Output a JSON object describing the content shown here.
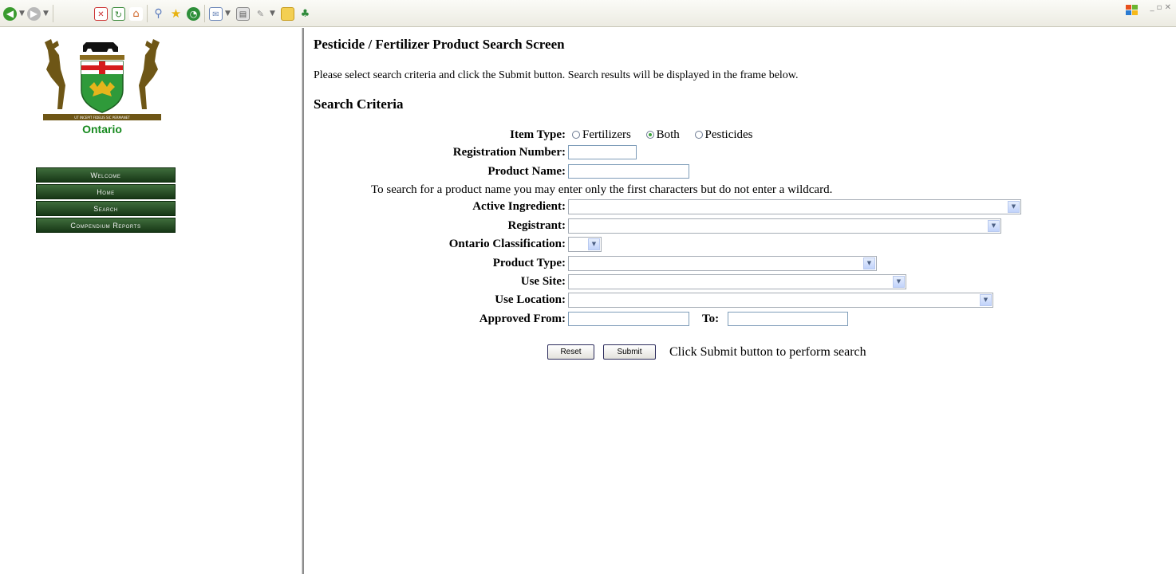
{
  "toolbar": {
    "icons": [
      "back-icon",
      "forward-icon",
      "stop-icon",
      "refresh-icon",
      "home-icon",
      "search-icon",
      "favorites-icon",
      "history-icon",
      "mail-icon",
      "print-icon",
      "edit-icon",
      "discuss-icon",
      "folder-icon",
      "messenger-icon"
    ]
  },
  "sidebar": {
    "logo_text": "Ontario",
    "items": [
      {
        "label": "Welcome"
      },
      {
        "label": "Home"
      },
      {
        "label": "Search"
      },
      {
        "label": "Compendium Reports"
      }
    ]
  },
  "main": {
    "title": "Pesticide / Fertilizer Product Search Screen",
    "instructions": "Please select search criteria and click the Submit button. Search results will be displayed in the frame below.",
    "section_title": "Search Criteria",
    "item_type": {
      "label": "Item Type:",
      "options": [
        {
          "label": "Fertilizers",
          "checked": false
        },
        {
          "label": "Both",
          "checked": true
        },
        {
          "label": "Pesticides",
          "checked": false
        }
      ]
    },
    "registration_number": {
      "label": "Registration Number:",
      "value": ""
    },
    "product_name": {
      "label": "Product Name:",
      "value": ""
    },
    "product_name_note": "To search for a product name you may enter only the first characters but do not enter a wildcard.",
    "active_ingredient": {
      "label": "Active Ingredient:",
      "value": ""
    },
    "registrant": {
      "label": "Registrant:",
      "value": ""
    },
    "ontario_classification": {
      "label": "Ontario Classification:",
      "value": ""
    },
    "product_type": {
      "label": "Product Type:",
      "value": ""
    },
    "use_site": {
      "label": "Use Site:",
      "value": ""
    },
    "use_location": {
      "label": "Use Location:",
      "value": ""
    },
    "approved_from": {
      "label": "Approved From:",
      "value": ""
    },
    "approved_to": {
      "label": "To:",
      "value": ""
    },
    "reset_label": "Reset",
    "submit_label": "Submit",
    "submit_hint": "Click Submit button to perform search"
  },
  "colors": {
    "nav_green": "#1f471d",
    "logo_green": "#178a1f"
  }
}
